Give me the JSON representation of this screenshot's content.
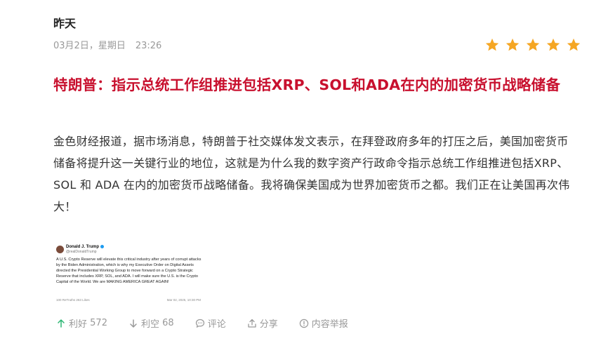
{
  "header": {
    "day_label": "昨天",
    "date": "03月2日，星期日",
    "time": "23:26"
  },
  "rating": {
    "stars": 5,
    "max": 5,
    "color": "#f5a623"
  },
  "article": {
    "title": "特朗普：指示总统工作组推进包括XRP、SOL和ADA在内的加密货币战略储备",
    "title_color": "#c8102e",
    "body": "金色财经报道，据市场消息，特朗普于社交媒体发文表示，在拜登政府多年的打压之后，美国加密货币储备将提升这一关键行业的地位，这就是为什么我的数字资产行政命令指示总统工作组推进包括XRP、SOL 和 ADA 在内的加密货币战略储备。我将确保美国成为世界加密货币之都。我们正在让美国再次伟大！"
  },
  "tweet_image": {
    "name": "Donald J. Trump",
    "handle": "@realDonaldTrump",
    "text": "A U.S. Crypto Reserve will elevate this critical industry after years of corrupt attacks by the Biden Administration, which is why my Executive Order on Digital Assets directed the Presidential Working Group to move forward on a Crypto Strategic Reserve that includes XRP, SOL, and ADA. I will make sure the U.S. is the Crypto Capital of the World. We are MAKING AMERICA GREAT AGAIN!",
    "footer_left": "100 ReTruths  263 Likes",
    "footer_right": "Mar 02, 2025, 10:30 PM"
  },
  "actions": {
    "bullish_label": "利好",
    "bullish_count": "572",
    "bearish_label": "利空",
    "bearish_count": "68",
    "comment_label": "评论",
    "share_label": "分享",
    "report_label": "内容举报"
  }
}
